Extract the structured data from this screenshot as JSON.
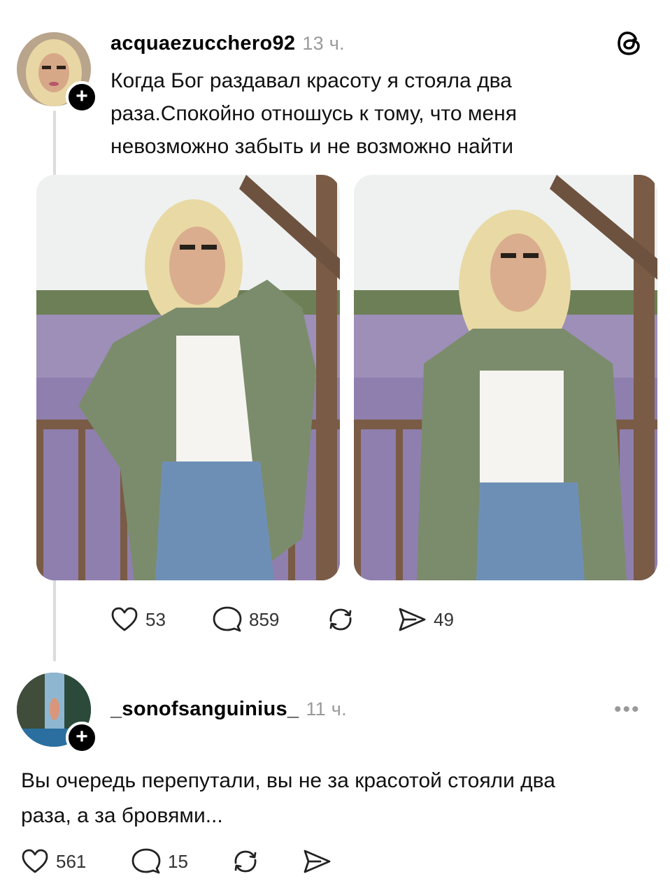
{
  "post": {
    "username": "acquaezucchero92",
    "time": "13 ч.",
    "text_line1": "Когда Бог раздавал красоту я стояла два",
    "text_line2": "раза.Спокойно отношусь к тому, что меня",
    "text_line3": "невозможно забыть и не возможно найти",
    "likes": "53",
    "comments": "859",
    "shares": "49",
    "follow_label": "+"
  },
  "reply": {
    "username": "_sonofsanguinius_",
    "time": "11 ч.",
    "text_line1": "Вы очередь перепутали, вы не за красотой стояли два",
    "text_line2": "раза, а за бровями...",
    "likes": "561",
    "comments": "15",
    "follow_label": "+",
    "more_label": "•••"
  },
  "icons": {
    "app_logo": "threads-logo-icon",
    "like": "heart-icon",
    "comment": "comment-bubble-icon",
    "repost": "repost-icon",
    "share": "send-icon",
    "more": "more-dots-icon"
  }
}
